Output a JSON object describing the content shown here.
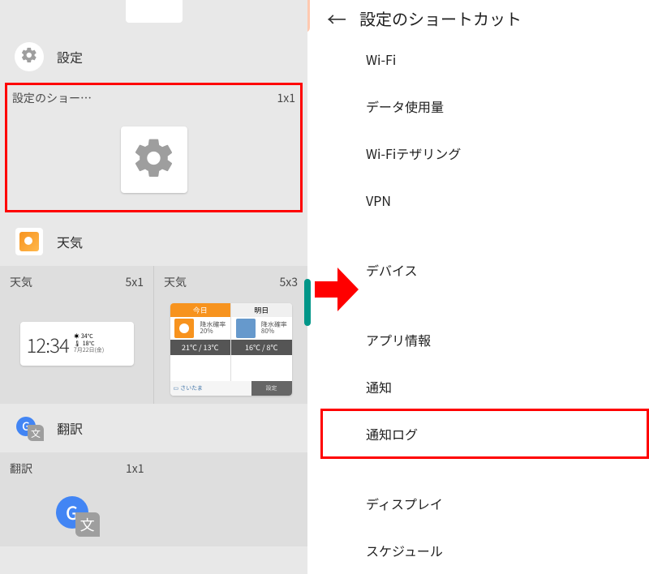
{
  "left": {
    "settings": {
      "section_title": "設定",
      "widget_label": "設定のショー…",
      "widget_size": "1x1"
    },
    "weather": {
      "section_title": "天気",
      "widget1_label": "天気",
      "widget1_size": "5x1",
      "widget2_label": "天気",
      "widget2_size": "5x3",
      "clock_time": "12:34",
      "clock_temp": "34℃",
      "clock_temp2": "18℃",
      "clock_date": "7月22日(金)",
      "day_today_label": "今日",
      "day_tomorrow_label": "明日",
      "today_rain_label": "降水確率",
      "today_rain": "20%",
      "tomorrow_rain_label": "降水確率",
      "tomorrow_rain": "80%",
      "today_temps": "21℃ / 13℃",
      "tomorrow_temps": "16℃ / 8℃",
      "weather_source": "さいたま",
      "weather_settings": "設定"
    },
    "translate": {
      "section_title": "翻訳",
      "widget_label": "翻訳",
      "widget_size": "1x1",
      "g_label": "G",
      "jp_label": "文"
    }
  },
  "right": {
    "title": "設定のショートカット",
    "items": [
      "Wi-Fi",
      "データ使用量",
      "Wi-Fiテザリング",
      "VPN",
      "デバイス",
      "アプリ情報",
      "通知",
      "通知ログ",
      "ディスプレイ",
      "スケジュール"
    ]
  }
}
